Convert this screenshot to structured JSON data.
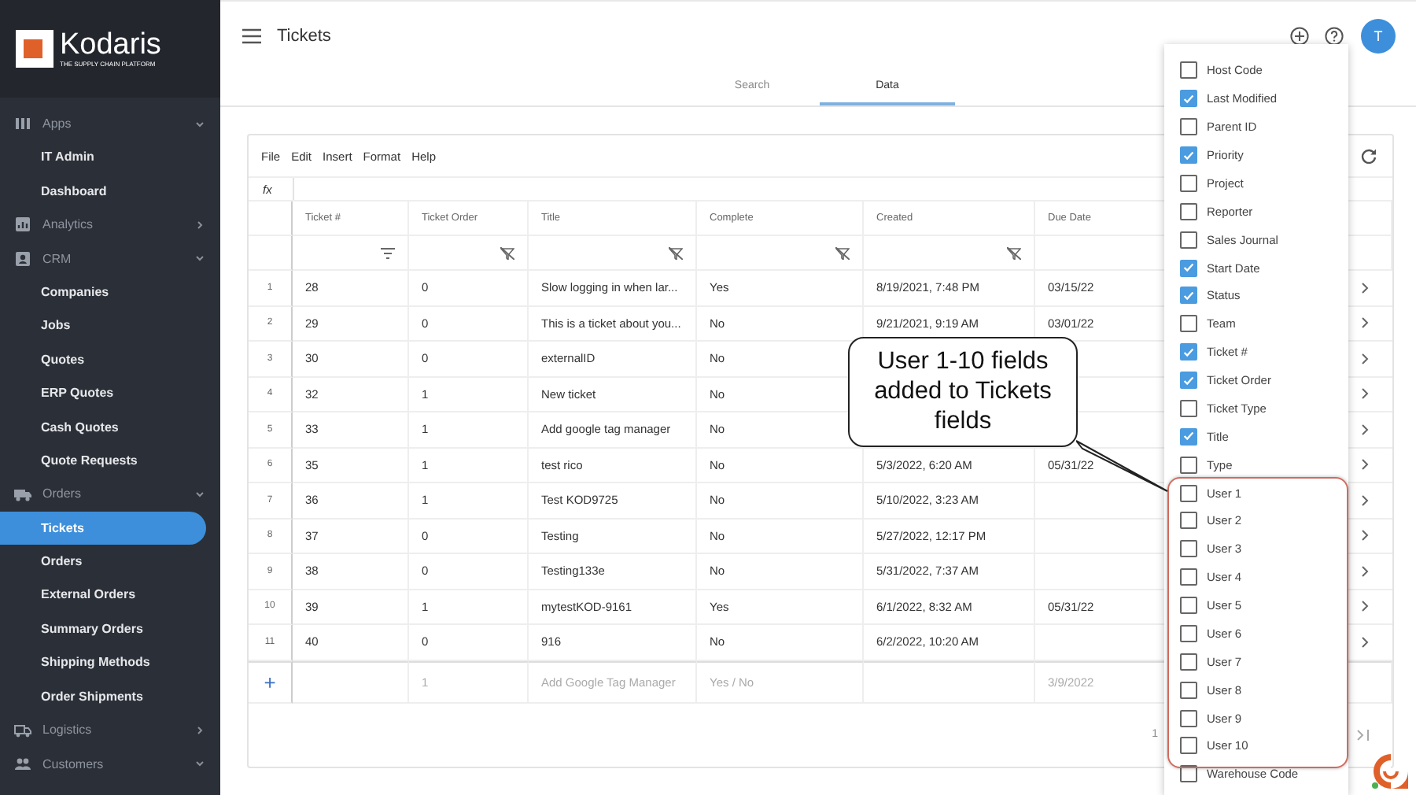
{
  "brand": {
    "name": "Kodaris",
    "tagline": "THE SUPPLY CHAIN PLATFORM"
  },
  "sidebar": {
    "sections": [
      {
        "label": "Apps",
        "expanded": true,
        "children": [
          {
            "label": "IT Admin",
            "selected": false
          },
          {
            "label": "Dashboard",
            "selected": false
          }
        ]
      },
      {
        "label": "Analytics",
        "expanded": false
      },
      {
        "label": "CRM",
        "expanded": true,
        "children": [
          {
            "label": "Companies",
            "selected": false
          },
          {
            "label": "Jobs",
            "selected": false
          },
          {
            "label": "Quotes",
            "selected": false
          },
          {
            "label": "ERP Quotes",
            "selected": false
          },
          {
            "label": "Cash Quotes",
            "selected": false
          },
          {
            "label": "Quote Requests",
            "selected": false
          }
        ]
      },
      {
        "label": "Orders",
        "expanded": true,
        "children": [
          {
            "label": "Tickets",
            "selected": true
          },
          {
            "label": "Orders",
            "selected": false
          },
          {
            "label": "External Orders",
            "selected": false
          },
          {
            "label": "Summary Orders",
            "selected": false
          },
          {
            "label": "Shipping Methods",
            "selected": false
          },
          {
            "label": "Order Shipments",
            "selected": false
          }
        ]
      },
      {
        "label": "Logistics",
        "expanded": false
      },
      {
        "label": "Customers",
        "expanded": true
      }
    ]
  },
  "header": {
    "title": "Tickets",
    "avatar": "T"
  },
  "tabs": [
    {
      "label": "Search",
      "selected": false
    },
    {
      "label": "Data",
      "selected": true
    }
  ],
  "grid": {
    "menu": [
      "File",
      "Edit",
      "Insert",
      "Format",
      "Help"
    ],
    "formula_label": "fx",
    "columns": [
      {
        "label": "Ticket #",
        "kind": "filtered"
      },
      {
        "label": "Ticket Order",
        "kind": "unfiltered"
      },
      {
        "label": "Title",
        "kind": "unfiltered"
      },
      {
        "label": "Complete",
        "kind": "unfiltered"
      },
      {
        "label": "Created",
        "kind": "unfiltered"
      },
      {
        "label": "Due Date",
        "kind": "plain"
      }
    ],
    "rows": [
      {
        "n": "1",
        "ticket": "28",
        "order": "0",
        "title": "Slow logging in when lar...",
        "complete": "Yes",
        "created": "8/19/2021, 7:48 PM",
        "due": "03/15/22"
      },
      {
        "n": "2",
        "ticket": "29",
        "order": "0",
        "title": "This is a ticket about you...",
        "complete": "No",
        "created": "9/21/2021, 9:19 AM",
        "due": "03/01/22"
      },
      {
        "n": "3",
        "ticket": "30",
        "order": "0",
        "title": "externalID",
        "complete": "No"
      },
      {
        "n": "4",
        "ticket": "32",
        "order": "1",
        "title": "New ticket",
        "complete": "No"
      },
      {
        "n": "5",
        "ticket": "33",
        "order": "1",
        "title": "Add google tag manager",
        "complete": "No"
      },
      {
        "n": "6",
        "ticket": "35",
        "order": "1",
        "title": "test rico",
        "complete": "No",
        "created": "5/3/2022, 6:20 AM",
        "due": "05/31/22"
      },
      {
        "n": "7",
        "ticket": "36",
        "order": "1",
        "title": "Test KOD9725",
        "complete": "No",
        "created": "5/10/2022, 3:23 AM"
      },
      {
        "n": "8",
        "ticket": "37",
        "order": "0",
        "title": "Testing",
        "complete": "No",
        "created": "5/27/2022, 12:17 PM"
      },
      {
        "n": "9",
        "ticket": "38",
        "order": "0",
        "title": "Testing133e",
        "complete": "No",
        "created": "5/31/2022, 7:37 AM"
      },
      {
        "n": "10",
        "ticket": "39",
        "order": "1",
        "title": "mytestKOD-9161",
        "complete": "Yes",
        "created": "6/1/2022, 8:32 AM",
        "due": "05/31/22"
      },
      {
        "n": "11",
        "ticket": "40",
        "order": "0",
        "title": "916",
        "complete": "No",
        "created": "6/2/2022, 10:20 AM"
      }
    ],
    "new_row": {
      "add": "+",
      "order": "1",
      "title": "Add Google Tag Manager",
      "complete": "Yes / No",
      "due": "3/9/2022"
    },
    "page": "1"
  },
  "column_menu": [
    {
      "label": "Host Code",
      "checked": false
    },
    {
      "label": "Last Modified",
      "checked": true
    },
    {
      "label": "Parent ID",
      "checked": false
    },
    {
      "label": "Priority",
      "checked": true
    },
    {
      "label": "Project",
      "checked": false
    },
    {
      "label": "Reporter",
      "checked": false
    },
    {
      "label": "Sales Journal",
      "checked": false
    },
    {
      "label": "Start Date",
      "checked": true
    },
    {
      "label": "Status",
      "checked": true
    },
    {
      "label": "Team",
      "checked": false
    },
    {
      "label": "Ticket #",
      "checked": true
    },
    {
      "label": "Ticket Order",
      "checked": true
    },
    {
      "label": "Ticket Type",
      "checked": false
    },
    {
      "label": "Title",
      "checked": true
    },
    {
      "label": "Type",
      "checked": false
    },
    {
      "label": "User 1",
      "checked": false
    },
    {
      "label": "User 2",
      "checked": false
    },
    {
      "label": "User 3",
      "checked": false
    },
    {
      "label": "User 4",
      "checked": false
    },
    {
      "label": "User 5",
      "checked": false
    },
    {
      "label": "User 6",
      "checked": false
    },
    {
      "label": "User 7",
      "checked": false
    },
    {
      "label": "User 8",
      "checked": false
    },
    {
      "label": "User 9",
      "checked": false
    },
    {
      "label": "User 10",
      "checked": false
    },
    {
      "label": "Warehouse Code",
      "checked": false
    }
  ],
  "callout": {
    "text": "User 1-10 fields added to Tickets fields"
  }
}
